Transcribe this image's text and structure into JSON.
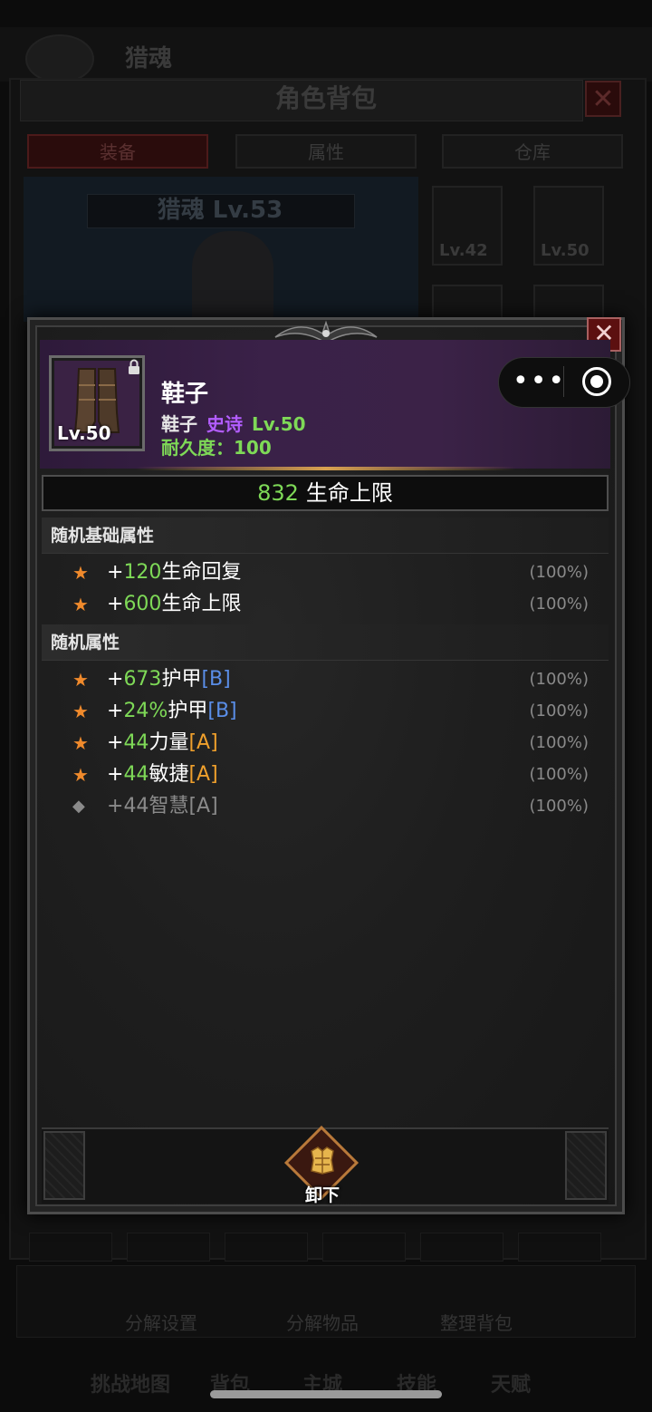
{
  "background": {
    "player_name": "猎魂",
    "window_title": "角色背包",
    "tabs": [
      {
        "label": "装备",
        "active": true
      },
      {
        "label": "属性",
        "active": false
      },
      {
        "label": "仓库",
        "active": false
      }
    ],
    "character_label": "猎魂 Lv.53",
    "slots": [
      {
        "level": "Lv.42"
      },
      {
        "level": "Lv.50"
      }
    ],
    "actions": [
      "分解设置",
      "分解物品",
      "整理背包"
    ],
    "nav": [
      "挑战地图",
      "背包",
      "主城",
      "技能",
      "天赋"
    ]
  },
  "item": {
    "level_badge": "Lv.50",
    "name": "鞋子",
    "type": "鞋子",
    "rarity": "史诗",
    "rarity_color": "#b35dff",
    "level": "Lv.50",
    "durability": "耐久度：100",
    "main_stat": {
      "value": "832",
      "name": "生命上限"
    }
  },
  "sections": {
    "base_title": "随机基础属性",
    "base": [
      {
        "bullet": "star",
        "plus": "+",
        "value": "120",
        "name": "生命回复",
        "tier": "",
        "pct": "(100%)"
      },
      {
        "bullet": "star",
        "plus": "+",
        "value": "600",
        "name": "生命上限",
        "tier": "",
        "pct": "(100%)"
      }
    ],
    "random_title": "随机属性",
    "random": [
      {
        "bullet": "star",
        "plus": "+",
        "value": "673",
        "name": "护甲",
        "tier": "[B]",
        "pct": "(100%)"
      },
      {
        "bullet": "star",
        "plus": "+",
        "value": "24%",
        "name": "护甲",
        "tier": "[B]",
        "pct": "(100%)"
      },
      {
        "bullet": "star",
        "plus": "+",
        "value": "44",
        "name": "力量",
        "tier": "[A]",
        "pct": "(100%)"
      },
      {
        "bullet": "star",
        "plus": "+",
        "value": "44",
        "name": "敏捷",
        "tier": "[A]",
        "pct": "(100%)"
      },
      {
        "bullet": "diamond",
        "plus": "+",
        "value": "44",
        "name": "智慧",
        "tier": "[A]",
        "pct": "(100%)"
      }
    ]
  },
  "buttons": {
    "unequip_label": "卸下",
    "close_glyph": "✕",
    "capsule_more": "•••"
  }
}
